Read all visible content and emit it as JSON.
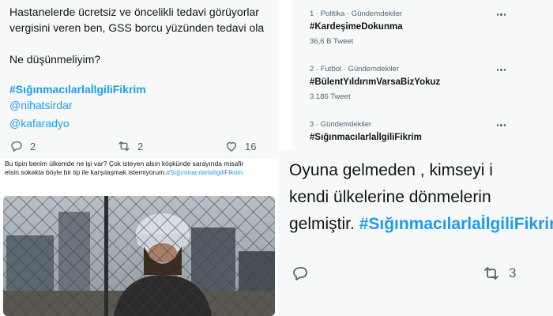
{
  "tweet_top": {
    "line1": "Hastanelerde ücretsiz ve öncelikli tedavi görüyorlar",
    "line2": "vergisini veren ben, GSS borcu yüzünden tedavi ola",
    "question": "Ne düşünmeliyim?",
    "hashtag": "#SığınmacılarlaİlgiliFikrim",
    "mention1": "@nihatsirdar",
    "mention2": "@kafaradyo",
    "replies": "2",
    "retweets": "2",
    "likes": "16"
  },
  "trends": [
    {
      "category": "1 · Politika · Gündemdekiler",
      "name": "#KardeşimeDokunma",
      "count": "36,6 B Tweet"
    },
    {
      "category": "2 · Futbol · Gündemdekiler",
      "name": "#BülentYıldırımVarsaBizYokuz",
      "count": "3.186 Tweet"
    },
    {
      "category": "3 · Gündemdekiler",
      "name": "#SığınmacılarlaİlgiliFikrim",
      "count": ""
    }
  ],
  "tweet_photo": {
    "caption": "Bu tipin benim ülkemde ne işi var? Çok isteyen alsın köşkünde sarayında misafir etsin.sokakta böyle bir tip ile karşılaşmak istemiyorum.",
    "hashtag": "#SığınmacılarlaİlgiliFikrim"
  },
  "tweet_zoom": {
    "line1": "Oyuna gelmeden , kimseyi i",
    "line2": "kendi ülkelerine dönmelerin",
    "line3_prefix": "gelmiştir. ",
    "line3_hashtag": "#SığınmacılarlaİlgiliFikrim",
    "retweets": "3"
  },
  "colors": {
    "accent": "#1d9bf0",
    "text": "#0f1419",
    "muted": "#536471",
    "bg": "#f7f9f9"
  },
  "icons": [
    "reply-icon",
    "retweet-icon",
    "like-icon",
    "more-icon"
  ]
}
